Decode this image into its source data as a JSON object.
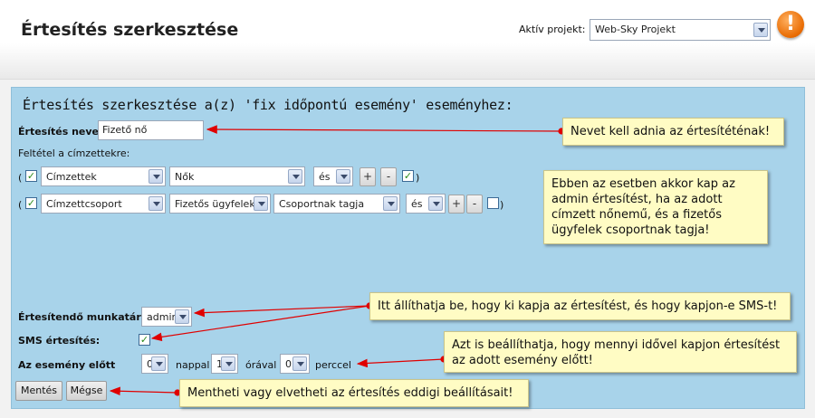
{
  "header": {
    "title": "Értesítés szerkesztése",
    "project_label": "Aktív projekt:",
    "project_value": "Web-Sky Projekt",
    "alert_symbol": "!"
  },
  "panel": {
    "title": "Értesítés szerkesztése a(z) 'fix időpontú esemény' eseményhez:",
    "name_label": "Értesítés neve:",
    "name_value": "Fizető nő",
    "condition_label": "Feltétel a címzettekre:",
    "row1": {
      "open": "(",
      "field": "Címzettek",
      "value": "Nők",
      "operator": "és",
      "plus": "+",
      "minus": "-",
      "close": ")"
    },
    "row2": {
      "open": "(",
      "field": "Címzettcsoport",
      "value": "Fizetős ügyfelek",
      "relation": "Csoportnak tagja",
      "operator": "és",
      "plus": "+",
      "minus": "-",
      "close": ")"
    },
    "employee_label": "Értesítendő munkatárs:",
    "employee_value": "admin",
    "sms_label": "SMS értesítés:",
    "before_label": "Az esemény előtt",
    "days_value": "0",
    "days_unit": "nappal",
    "hours_value": "1",
    "hours_unit": "órával",
    "minutes_value": "0",
    "minutes_unit": "perccel",
    "save_label": "Mentés",
    "cancel_label": "Mégse"
  },
  "notes": {
    "name": "Nevet kell adnia az értesítéténak!",
    "condition": "Ebben az esetben akkor kap az admin értesítést, ha az adott címzett nőnemű, és a fizetős ügyfelek csoportnak tagja!",
    "employee": "Itt állíthatja be, hogy ki kapja az értesítést, és hogy kapjon-e SMS-t!",
    "timing": "Azt is beállíthatja, hogy mennyi idővel kapjon értesítést az adott esemény előtt!",
    "save": "Mentheti vagy elvetheti az értesítés eddigi beállításait!"
  },
  "colors": {
    "panel_bg": "#a8d3ea",
    "note_bg": "#fffcc4",
    "arrow_red": "#e00000",
    "alert_orange": "#e86a00"
  }
}
